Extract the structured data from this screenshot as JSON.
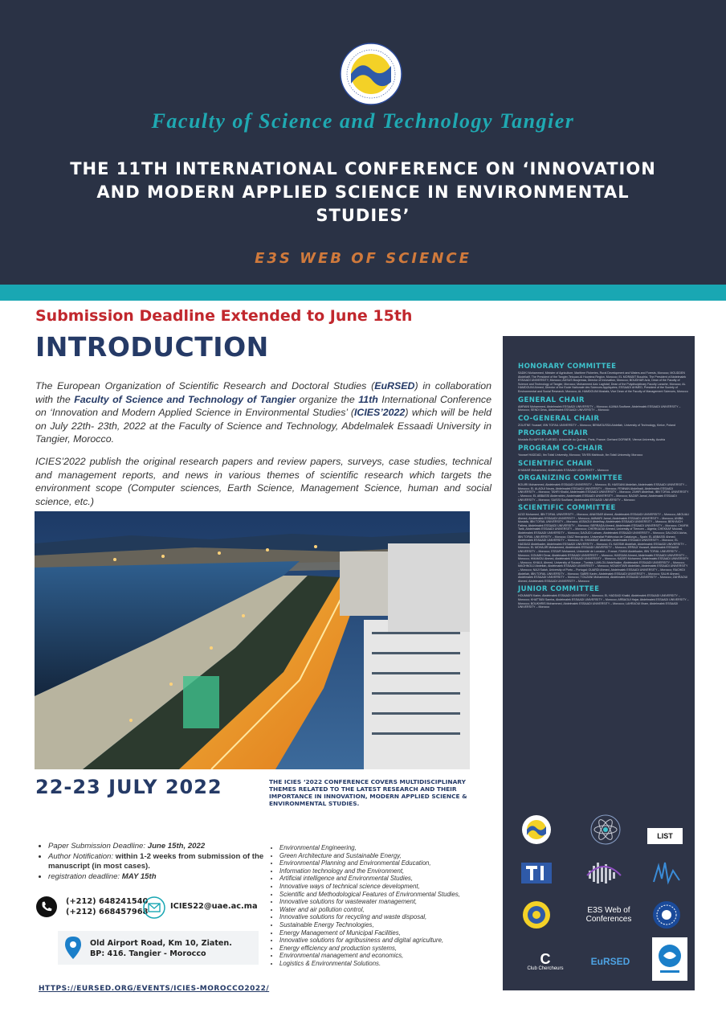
{
  "header": {
    "faculty": "Faculty of Science and Technology Tangier",
    "title": "THE 11TH INTERNATIONAL CONFERENCE ON ‘INNOVATION AND MODERN APPLIED SCIENCE IN ENVIRONMENTAL STUDIES’",
    "subtitle": "E3S WEB OF SCIENCE"
  },
  "colors": {
    "navy": "#2a3245",
    "teal": "#19a7b3",
    "orange": "#d07a3c",
    "red": "#c1272d",
    "dark_blue": "#253a66"
  },
  "deadline_banner": "Submission Deadline Extended to June 15th",
  "intro": {
    "heading": "INTRODUCTION",
    "p1": {
      "a": "The European Organization of Scientific Research and Doctoral Studies (",
      "b": "EuRSED",
      "c": ") in collaboration with the ",
      "d": "Faculty of Science and Technology of Tangier",
      "e": " organize the ",
      "f": "11th",
      "g": " International Conference on ‘Innovation and Modern Applied Science in Environmental Studies’ (",
      "h": "ICIES’2022",
      "i": ") which will be held on July 22th- 23th, 2022 at the Faculty of Science and Technology, Abdelmalek Essaadi University in Tangier, Morocco."
    },
    "p2": "ICIES’2022 publish the original research papers and review papers, surveys, case studies, technical and management reports, and news in various themes of scientific research which targets the environment scope (Computer sciences, Earth Science, Management Science, human and social science, etc.)"
  },
  "event_date": "22-23 JULY 2022",
  "themes_intro": "THE ICIES ‘2022 CONFERENCE COVERS MULTIDISCIPLINARY THEMES RELATED TO THE LATEST RESEARCH AND THEIR IMPORTANCE IN INNOVATION, MODERN APPLIED SCIENCE & ENVIRONMENTAL STUDIES.",
  "dates": [
    {
      "label": "Paper Submission Deadline: ",
      "value": "June 15th, 2022"
    },
    {
      "label": "Author Notification:  ",
      "value": "within 1-2 weeks from submission of the manuscript (in most cases)."
    },
    {
      "label": "registration deadline: ",
      "value": "MAY 15th"
    }
  ],
  "themes": [
    "Environmental Engineering,",
    "Green Architecture and Sustainable Energy,",
    "Environmental Planning and Environmental Education,",
    "Information technology and the Environment,",
    "Artificial intelligence and Environmental Studies,",
    "Innovative ways of technical science development,",
    "Scientific and Methodological Features of Environmental Studies,",
    "Innovative solutions for wastewater management,",
    "Water and air pollution control,",
    "Innovative solutions for recycling and waste disposal,",
    "Sustainable Energy Technologies,",
    "Energy Management of Municipal Facilities,",
    "Innovative solutions for agribusiness and digital agriculture,",
    "Energy efficiency and production systems,",
    "Environmental management and economics,",
    "Logistics & Environmental Solutions."
  ],
  "contact": {
    "phone1": "(+212) 648241540",
    "phone2": "(+212) 668457968",
    "email": "ICIES22@uae.ac.ma",
    "address1": "Old Airport Road, Km 10, Ziaten.",
    "address2": "BP: 416. Tangier - Morocco",
    "url": "HTTPS://EURSED.ORG/EVENTS/ICIES-MOROCCO2022/"
  },
  "committees": [
    {
      "title": "HONORARY COMMITTEE",
      "names": "SADIKI Mohammed, Minister of Agriculture, Maritime Fisheries, Rural Development and Waters and Forests, Morocco; MOUDDEN Abdellatif, The President of the Tangier-Tetouan-Al Hoceima Region, Morocco; EL MORABIT Bouchta, The President of Abdelmalek ESSAADI UNIVERSITY, Morocco; ADSUS Boujemaa, Director of Innovation, Morocco; BOUDHAR Aziz, Dean of the Faculty of Science and Technology of Tangier, Morocco; Mohammed Aziz Laghdaf, Dean of the Polydisciplinary Faculty Larache, Morocco; AL HAMDOUNI Ahmed, Director of the Ecole Nationale des Sciences Appliquées; ESSAADI AHMED, President of the Society of Environmental and Social Research; Morocco; AL HAMDOUNI Mostafa, Vice Dean of the Faculty of Management Sciences, Morocco"
    },
    {
      "title": "GENERAL CHAIR",
      "names": "AMRANI Mohammed, Abdelmalek ESSAADI UNIVERSITY – Morocco; AJANA Soufiane, Abdelmalek ESSAADI UNIVERSITY – Morocco; SENDI Driss, Abdelmalek ESSAADI UNIVERSITY – Morocco"
    },
    {
      "title": "CO-GENERAL CHAIR",
      "names": "ZOUITNE Youssef, IBN TOFAIL UNIVERSITY – Morocco; BENMOUSSA Abdellah, University of Technology, Kielce, Poland"
    },
    {
      "title": "PROGRAM CHAIR",
      "names": "Mostafa ELHAFFAR, EuRSED, Université du Québec, Paris, France; Gerhard DORNER, Vienna University, Austria"
    },
    {
      "title": "PROGRAM CO-CHAIR",
      "names": "Youssef HADDAD, Ibn Tofail University, Morocco; TAYEB Mahboub, Ibn Tofail University, Morocco"
    },
    {
      "title": "SCIENTIFIC CHAIR",
      "names": "KHAMAR Mohammed, Abdelmalek ESSAADI UNIVERSITY – Morocco"
    },
    {
      "title": "ORGANIZING COMMITTEE",
      "names": "BOUIRI Mohammed, Abdelmalek ESSAADI UNIVERSITY – Morocco; EL HASSANI Abdellah, Abdelmalek ESSAADI UNIVERSITY – Morocco; EL ALAOUI Noura, Abdelmalek ESSAADI UNIVERSITY – Morocco; FENNAN Abdelhadi, Abdelmalek ESSAADI UNIVERSITY – Morocco; TAHRI Khalid, Abdelmalek ESSAADI UNIVERSITY – Morocco; ZAHIR Abdelhak, IBN TOFAIL UNIVERSITY – Morocco; EL ABBASSI Abderrahim, Abdelmalek ESSAADI UNIVERSITY – Morocco; BAZAR Jamal, Abdelmalek ESSAADI UNIVERSITY – Morocco; SAISSI Soufiane, Abdelmalek ESSAADI UNIVERSITY – Morocco"
    },
    {
      "title": "SCIENTIFIC COMMITTEE",
      "names": "AZIZI Mohamed, IBN TOFAIL UNIVERSITY – Morocco; ANASSAR Ahmed, Abdelmalek ESSAADI UNIVERSITY – Morocco; ABOUALI Ahmed, Abdelmalek ESSAADI UNIVERSITY – Morocco; AMMARI Jamal, Abdelmalek ESSAADI UNIVERSITY – Morocco; ANIBA Mostafa, IBN TOFAIL UNIVERSITY – Morocco; ASSAOUI Abdelhay, Abdelmalek ESSAADI UNIVERSITY – Morocco; BENYAICH Fatima, Abdelmalek ESSAADI UNIVERSITY – Morocco; BERRADA Ahmed, Abdelmalek ESSAADI UNIVERSITY – Morocco; CHAFIK Tarik, Abdelmalek ESSAADI UNIVERSITY – Morocco; CHERKAOUI Ahmed, University of Tlemcen – Algeria; CHEKKAF Mourad, Abdelmalek ESSAADI UNIVERSITY – Morocco; DAOUDI Lahcen, Abdelmalek ESSAADI UNIVERSITY – Morocco; DALOUDI Aicha, IBN TOFAIL UNIVERSITY – Morocco; DIAZ Hernandez, Universitat Politècnica de Catalunya – Spain; EL ABBASSI Ahmed, Abdelmalek ESSAADI UNIVERSITY – Morocco; EL GHAMMAT Abdellah, Abdelmalek ESSAADI UNIVERSITY – Morocco; EL HADDAD Abdelkader, Abdelmalek ESSAADI UNIVERSITY – Morocco; EL KASSMI Abdellah, Abdelmalek ESSAADI UNIVERSITY – Morocco; EL MOHAJIR Mohammed, Abdelmalek ESSAADI UNIVERSITY – Morocco; ERRAJI Youssef, Abdelmalek ESSAADI UNIVERSITY – Morocco; ESSAFI Mohamed, Université de Lorraine – France; FAHIM Abdelkader, IBN TOFAIL UNIVERSITY – Morocco; GOUMIH Omar, Abdelmalek ESSAADI UNIVERSITY – Morocco; HASSANI Ahmed, Abdelmalek ESSAADI UNIVERSITY – Morocco; HMAMOU Ahmed, Abdelmalek ESSAADI UNIVERSITY – Morocco; KADIRI Mohamed, Abdelmalek ESSAADI UNIVERSITY – Morocco; KHALIL Ahmed, University of Sousse – Tunisia; LAHLOU Abdelhakim, Abdelmalek ESSAADI UNIVERSITY – Morocco; MAGHNOUJ Abdellah, Abdelmalek ESSAADI UNIVERSITY – Morocco; MOUKHTARI Abdelilah, Abdelmalek ESSAADI UNIVERSITY – Morocco; NAJI Salah, University of Porto – Portugal; OUARDI Ahmed, Abdelmalek ESSAADI UNIVERSITY – Morocco; RACHIDI Abdellah, IBN TOFAIL UNIVERSITY – Morocco; SABRI Karim, Abdelmalek ESSAADI UNIVERSITY – Morocco; SALHI Ahmed, Abdelmalek ESSAADI UNIVERSITY – Morocco; TOUZANI Mohammed, Abdelmalek ESSAADI UNIVERSITY – Morocco; ZAHRAOUI Ahmed, Abdelmalek ESSAADI UNIVERSITY – Morocco"
    },
    {
      "title": "JUNIOR COMMITTEE",
      "names": "HOUMAIRI Karim, Abdelmalek ESSAADI UNIVERSITY – Morocco; EL HADDAD Khalid, Abdelmalek ESSAADI UNIVERSITY – Morocco; KHATTABI Samira, Abdelmalek ESSAADI UNIVERSITY – Morocco; ARBAOUI Hajar, Abdelmalek ESSAADI UNIVERSITY – Morocco; BOUKHRIS Mohammed, Abdelmalek ESSAADI UNIVERSITY – Morocco; LAHRAOUI Ilham, Abdelmalek ESSAADI UNIVERSITY – Morocco"
    }
  ],
  "partner_logos": {
    "list": "LIST",
    "e3s_a": "E3S Web of",
    "e3s_b": "Conferences",
    "eursed": "EuRSED",
    "cs": "C",
    "club": "Club Chercheurs"
  }
}
